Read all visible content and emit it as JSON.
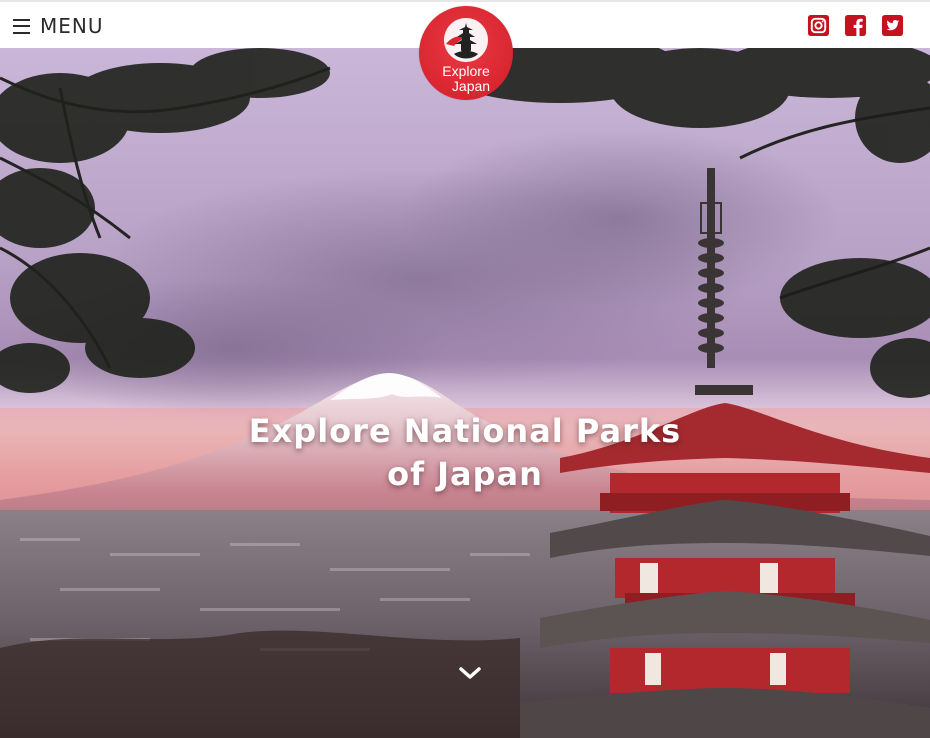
{
  "header": {
    "menu_label": "MENU",
    "menu_icon": "hamburger-icon",
    "social": [
      {
        "name": "instagram-icon",
        "color": "#c4121f"
      },
      {
        "name": "facebook-icon",
        "color": "#c4121f"
      },
      {
        "name": "twitter-icon",
        "color": "#c4121f"
      }
    ]
  },
  "logo": {
    "line1": "Explore",
    "line2": "Japan",
    "color": "#d9252f",
    "icon": "pagoda-icon"
  },
  "hero": {
    "title_line1": "Explore National Parks",
    "title_line2": "of Japan",
    "scroll_icon": "chevron-down-icon"
  },
  "colors": {
    "accent": "#c4121f",
    "header_bg": "#ffffff",
    "text": "#2b2b2b"
  }
}
